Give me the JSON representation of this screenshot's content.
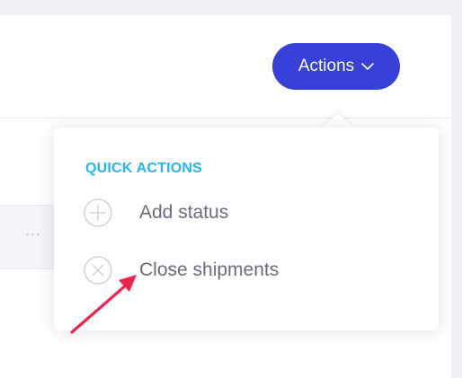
{
  "toolbar": {
    "actions_label": "Actions",
    "actions_icon": "chevron-down-icon",
    "accent_color": "#3741d8"
  },
  "table": {
    "row_menu_label": "···"
  },
  "dropdown": {
    "section_title": "QUICK ACTIONS",
    "section_color": "#21b6f4",
    "items": [
      {
        "label": "Add status",
        "icon": "plus-circle-icon"
      },
      {
        "label": "Close shipments",
        "icon": "x-circle-icon"
      }
    ]
  },
  "annotation": {
    "arrow_color": "#f0204f",
    "arrow_icon": "arrow-pointer-icon"
  }
}
